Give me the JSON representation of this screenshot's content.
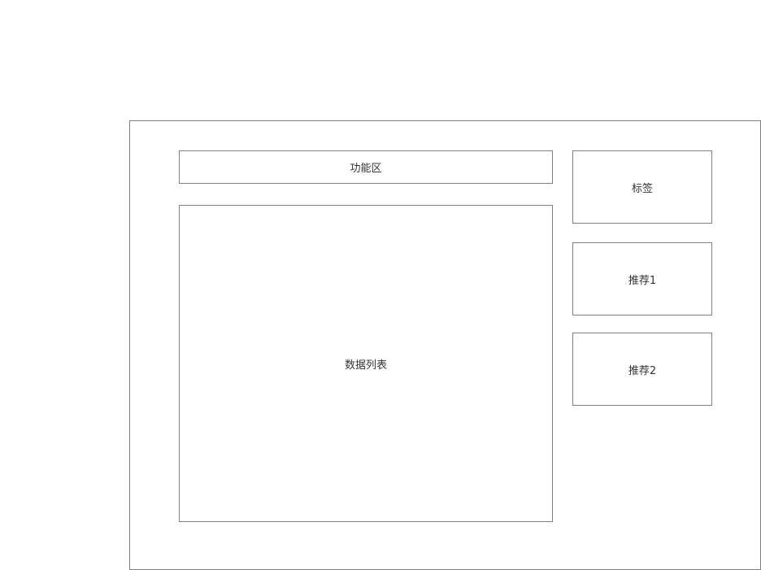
{
  "layout": {
    "function_area": "功能区",
    "data_list": "数据列表",
    "tags": "标签",
    "recommend_1": "推荐1",
    "recommend_2": "推荐2"
  }
}
